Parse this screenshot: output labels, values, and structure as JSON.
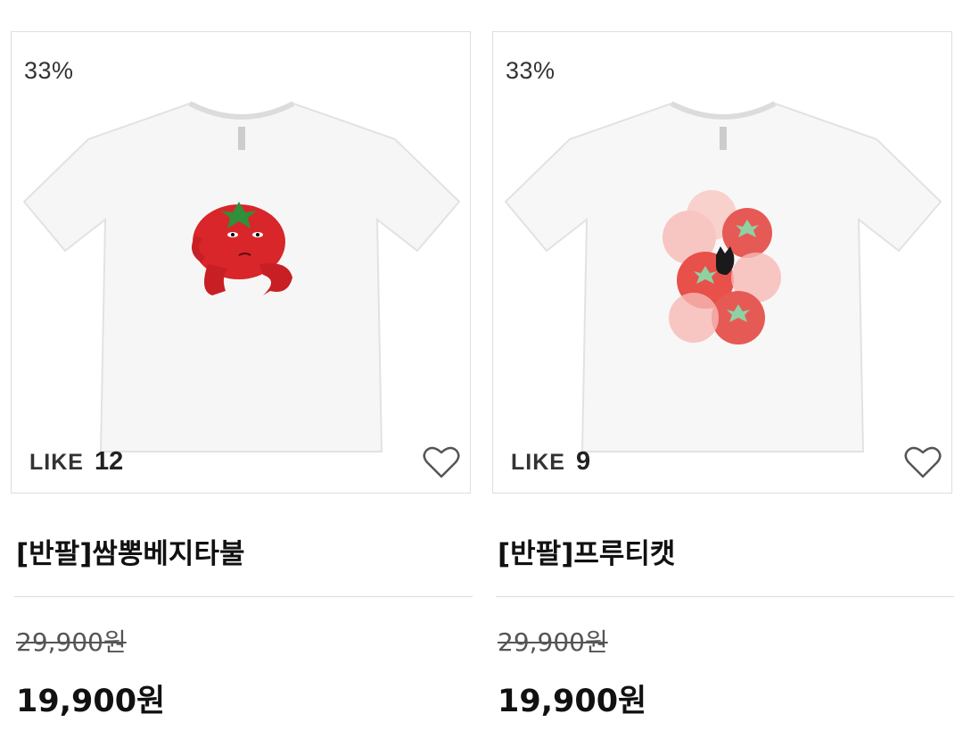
{
  "products": [
    {
      "discount": "33%",
      "like_label": "LIKE",
      "like_count": "12",
      "title": "[반팔]쌈뽕베지타불",
      "original_price": "29,900원",
      "sale_price": "19,900원",
      "image_icon": "tshirt-tomato-character-icon"
    },
    {
      "discount": "33%",
      "like_label": "LIKE",
      "like_count": "9",
      "title": "[반팔]프루티캣",
      "original_price": "29,900원",
      "sale_price": "19,900원",
      "image_icon": "tshirt-tomatoes-cat-icon"
    }
  ],
  "colors": {
    "tomato": "#d8262a",
    "leaf": "#2f8f3a",
    "heart_outline": "#555555"
  }
}
